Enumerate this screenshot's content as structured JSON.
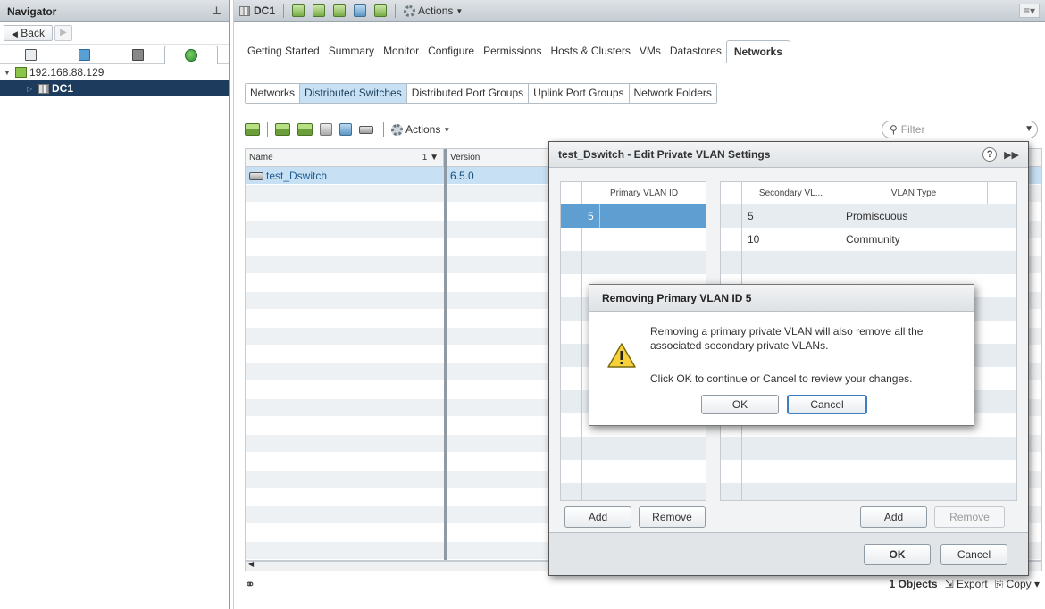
{
  "navigator": {
    "title": "Navigator",
    "back_label": "Back",
    "tree": [
      {
        "label": "192.168.88.129"
      },
      {
        "label": "DC1"
      }
    ]
  },
  "main": {
    "object_title": "DC1",
    "actions_label": "Actions",
    "tabs": [
      "Getting Started",
      "Summary",
      "Monitor",
      "Configure",
      "Permissions",
      "Hosts & Clusters",
      "VMs",
      "Datastores",
      "Networks"
    ],
    "active_tab": "Networks",
    "subtabs": [
      "Networks",
      "Distributed Switches",
      "Distributed Port Groups",
      "Uplink Port Groups",
      "Network Folders"
    ],
    "active_subtab": "Distributed Switches",
    "grid_actions_label": "Actions",
    "filter_placeholder": "Filter",
    "grid": {
      "columns": [
        "Name",
        "Version"
      ],
      "sort_indicator": "1 ▼",
      "rows": [
        {
          "name": "test_Dswitch",
          "version": "6.5.0"
        }
      ]
    },
    "status": {
      "count": "1 Objects",
      "export": "Export",
      "copy": "Copy"
    }
  },
  "edit_dialog": {
    "title": "test_Dswitch - Edit Private VLAN Settings",
    "primary_header": "Primary VLAN ID",
    "primary_rows": [
      "5"
    ],
    "secondary_headers": [
      "Secondary VL...",
      "VLAN Type"
    ],
    "secondary_rows": [
      {
        "id": "5",
        "type": "Promiscuous"
      },
      {
        "id": "10",
        "type": "Community"
      }
    ],
    "add_label": "Add",
    "remove_label": "Remove",
    "ok_label": "OK",
    "cancel_label": "Cancel"
  },
  "confirm_dialog": {
    "title": "Removing Primary VLAN ID 5",
    "line1": "Removing a primary private VLAN will also remove all the",
    "line2": "associated secondary private VLANs.",
    "line3": "Click OK to continue or Cancel to review your changes.",
    "ok_label": "OK",
    "cancel_label": "Cancel"
  }
}
